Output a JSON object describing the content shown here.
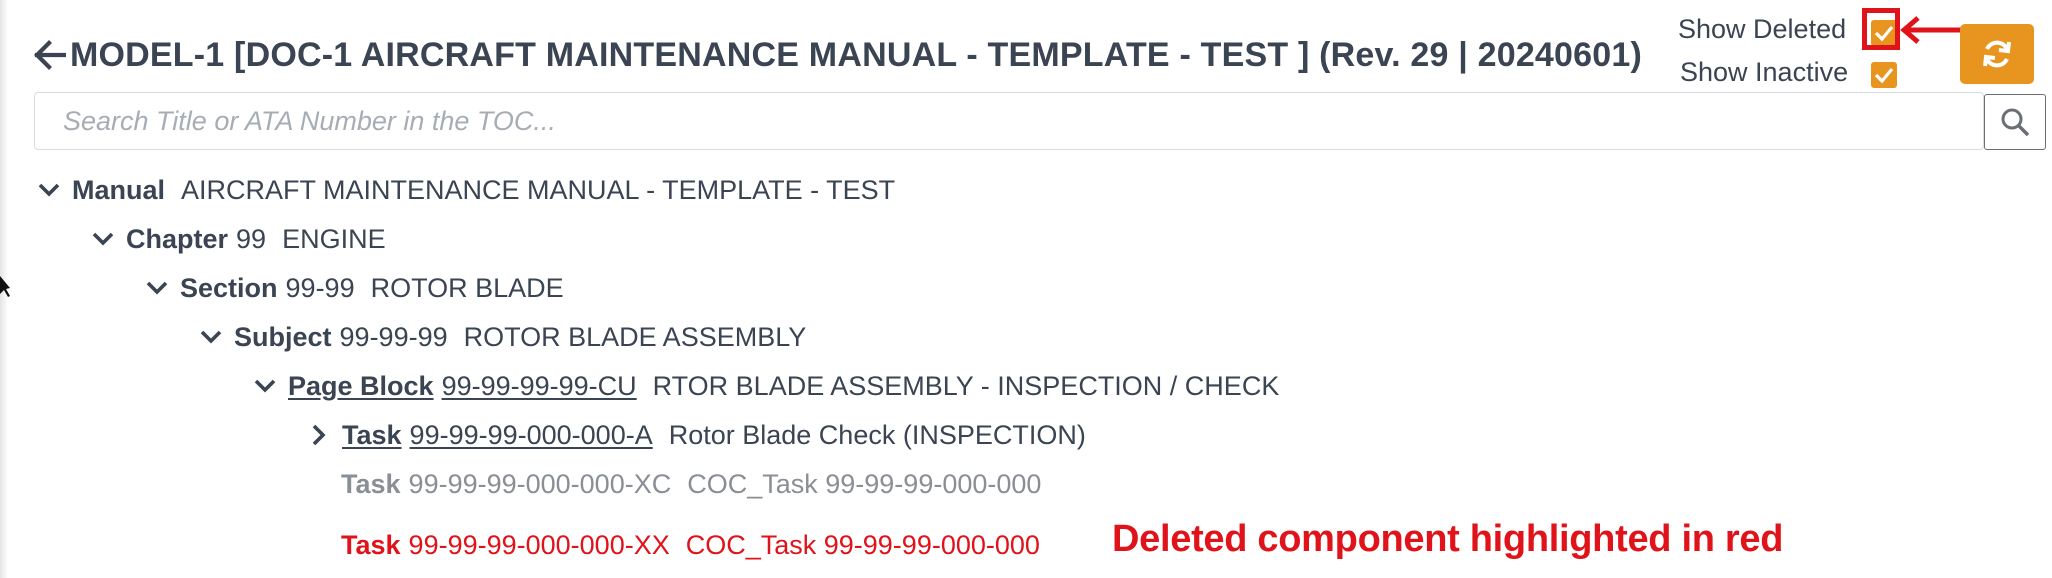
{
  "header": {
    "title": "MODEL-1 [DOC-1 AIRCRAFT MAINTENANCE MANUAL - TEMPLATE - TEST ] (Rev. 29 | 20240601)"
  },
  "toggles": {
    "show_deleted_label": "Show Deleted",
    "show_deleted_checked": true,
    "show_inactive_label": "Show Inactive",
    "show_inactive_checked": true
  },
  "search": {
    "placeholder": "Search Title or ATA Number in the TOC..."
  },
  "tree": [
    {
      "kind": "Manual",
      "number": "",
      "title": "AIRCRAFT MAINTENANCE MANUAL - TEMPLATE - TEST",
      "expanded": true,
      "state": "normal"
    },
    {
      "kind": "Chapter",
      "number": "99",
      "title": "ENGINE",
      "expanded": true,
      "state": "normal"
    },
    {
      "kind": "Section",
      "number": "99-99",
      "title": "ROTOR BLADE",
      "expanded": true,
      "state": "normal"
    },
    {
      "kind": "Subject",
      "number": "99-99-99",
      "title": "ROTOR BLADE ASSEMBLY",
      "expanded": true,
      "state": "normal"
    },
    {
      "kind": "Page Block",
      "number": "99-99-99-99-CU",
      "title": "RTOR BLADE ASSEMBLY - INSPECTION / CHECK",
      "expanded": true,
      "state": "link"
    },
    {
      "kind": "Task",
      "number": "99-99-99-000-000-A",
      "title": "Rotor Blade Check (INSPECTION)",
      "expanded": false,
      "state": "link"
    },
    {
      "kind": "Task",
      "number": "99-99-99-000-000-XC",
      "title": "COC_Task 99-99-99-000-000",
      "state": "inactive"
    },
    {
      "kind": "Task",
      "number": "99-99-99-000-000-XX",
      "title": "COC_Task 99-99-99-000-000",
      "state": "deleted"
    }
  ],
  "annotation": {
    "note": "Deleted component highlighted in red"
  },
  "colors": {
    "accent": "#e8951f",
    "text": "#3b4452",
    "inactive": "#8a8f96",
    "deleted": "#e0131a"
  }
}
